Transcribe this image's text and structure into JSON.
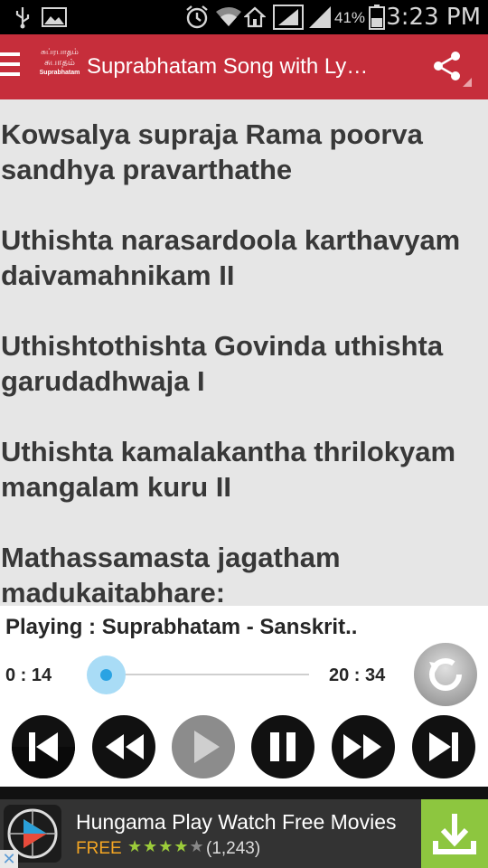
{
  "status_bar": {
    "battery_pct": "41%",
    "time": "3:23 PM",
    "icons": [
      "usb-icon",
      "image-icon",
      "alarm-icon",
      "wifi-icon",
      "home-icon",
      "signal-box-icon",
      "signal-icon",
      "battery-icon"
    ]
  },
  "app_bar": {
    "logo_line1": "சுப்ரபாதம்",
    "logo_line2": "சுபாதம்",
    "logo_line3": "Suprabhatam",
    "title": "Suprabhatam Song with Ly…",
    "color": "#c62e3b"
  },
  "lyrics": [
    "Kowsalya supraja Rama poorva sandhya pravarthathe",
    " Uthishta narasardoola karthavyam daivamahnikam II",
    " Uthishtothishta Govinda uthishta garudadhwaja I",
    " Uthishta kamalakantha thrilokyam mangalam kuru II",
    " Mathassamasta jagatham madukaitabhare:"
  ],
  "player": {
    "now_playing": "Playing : Suprabhatam - Sanskrit..",
    "current_time": "0 : 14",
    "total_time": "20 : 34",
    "progress": 0.011,
    "controls": [
      "skip-previous-icon",
      "rewind-icon",
      "play-icon",
      "fast-forward-icon",
      "pause-icon",
      "skip-next-icon",
      "repeat-icon"
    ]
  },
  "ad": {
    "title": "Hungama Play Watch Free Movies",
    "price": "FREE",
    "rating": 4,
    "rating_count": "(1,243)",
    "download_color": "#8dc63f",
    "close_label": "✕"
  }
}
